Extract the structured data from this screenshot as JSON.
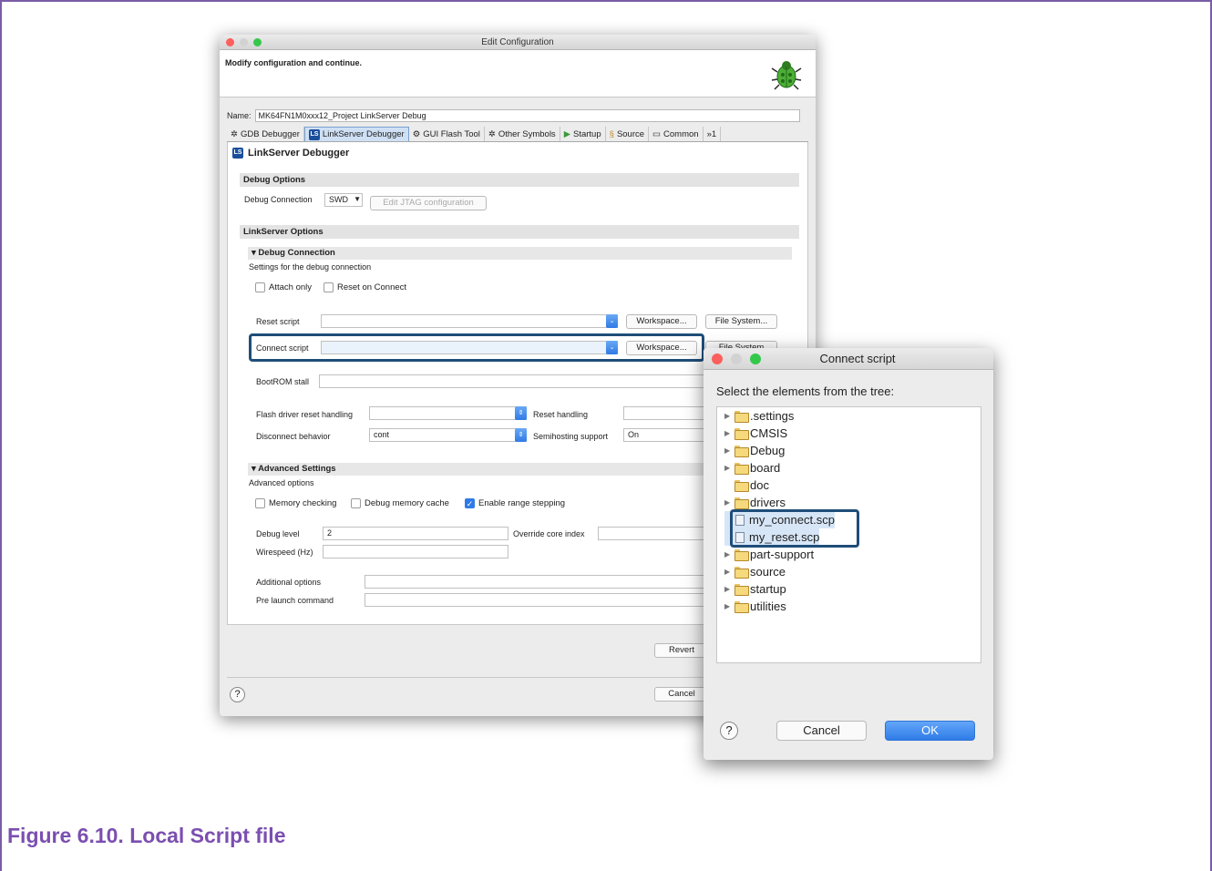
{
  "caption": "Figure 6.10. Local Script file",
  "main_dialog": {
    "title": "Edit Configuration",
    "message": "Modify configuration and continue.",
    "name_label": "Name:",
    "name_value": "MK64FN1M0xxx12_Project LinkServer Debug",
    "tabs": [
      "GDB Debugger",
      "LinkServer Debugger",
      "GUI Flash Tool",
      "Other Symbols",
      "Startup",
      "Source",
      "Common",
      "»1"
    ],
    "active_tab": "LinkServer Debugger",
    "panel_title": "LinkServer Debugger",
    "ls_badge": "LS",
    "debug_options": {
      "header": "Debug Options",
      "connection_label": "Debug Connection",
      "connection_value": "SWD",
      "jtag_button": "Edit JTAG configuration"
    },
    "linkserver_options": {
      "header": "LinkServer Options",
      "debug_connection_header": "Debug Connection",
      "debug_connection_desc": "Settings for the debug connection",
      "attach_only": "Attach only",
      "reset_on_connect": "Reset on Connect",
      "reset_script_label": "Reset script",
      "connect_script_label": "Connect script",
      "workspace_button": "Workspace...",
      "filesystem_button": "File System...",
      "filesystem_partial": "File System",
      "bootrom_label": "BootROM stall",
      "flash_reset_label": "Flash driver reset handling",
      "reset_handling_label": "Reset handling",
      "disconnect_label": "Disconnect behavior",
      "disconnect_value": "cont",
      "semihosting_label": "Semihosting support",
      "semihosting_value": "On"
    },
    "advanced": {
      "header": "Advanced Settings",
      "desc": "Advanced options",
      "memory_checking": "Memory checking",
      "debug_memory_cache": "Debug memory cache",
      "enable_range_stepping": "Enable range stepping",
      "debug_level_label": "Debug level",
      "debug_level_value": "2",
      "override_core_label": "Override core index",
      "wirespeed_label": "Wirespeed (Hz)",
      "additional_label": "Additional options",
      "prelaunch_label": "Pre launch command"
    },
    "revert_button": "Revert",
    "cancel_button": "Cancel",
    "help_icon": "?"
  },
  "popup": {
    "title": "Connect script",
    "prompt": "Select the elements from the tree:",
    "tree": [
      {
        "label": ".settings",
        "type": "folder",
        "expandable": true
      },
      {
        "label": "CMSIS",
        "type": "folder",
        "expandable": true
      },
      {
        "label": "Debug",
        "type": "folder",
        "expandable": true
      },
      {
        "label": "board",
        "type": "folder",
        "expandable": true
      },
      {
        "label": "doc",
        "type": "folder",
        "expandable": false
      },
      {
        "label": "drivers",
        "type": "folder",
        "expandable": true
      },
      {
        "label": "my_connect.scp",
        "type": "file",
        "expandable": false
      },
      {
        "label": "my_reset.scp",
        "type": "file",
        "expandable": false
      },
      {
        "label": "part-support",
        "type": "folder",
        "expandable": true
      },
      {
        "label": "source",
        "type": "folder",
        "expandable": true
      },
      {
        "label": "startup",
        "type": "folder",
        "expandable": true
      },
      {
        "label": "utilities",
        "type": "folder",
        "expandable": true
      }
    ],
    "cancel_button": "Cancel",
    "ok_button": "OK",
    "help_icon": "?"
  },
  "colors": {
    "caption": "#7b4fb0",
    "highlight_border": "#1f4e79",
    "ok_button": "#2f7ce8",
    "frame_border": "#7a5ca6"
  }
}
